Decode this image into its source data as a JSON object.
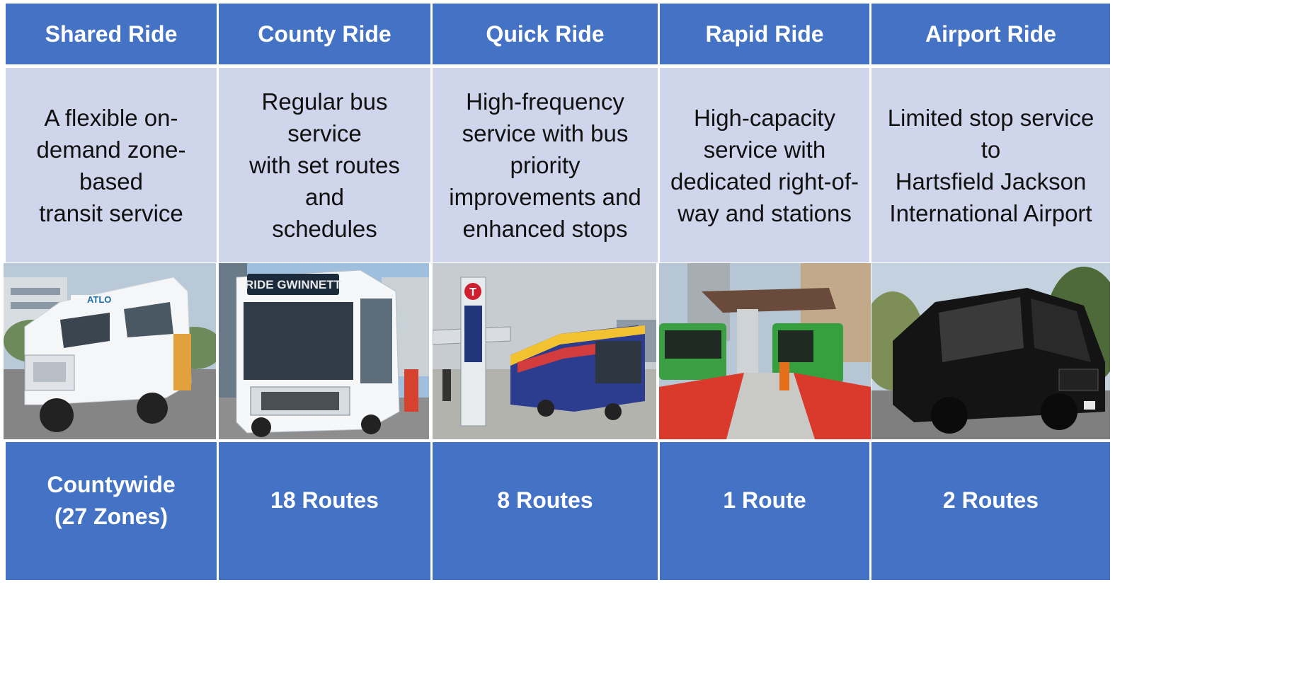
{
  "columns": [
    {
      "title": "Shared Ride",
      "description": "A flexible on-\ndemand zone-based\ntransit service",
      "coverage": "Countywide\n(27 Zones)",
      "photo": "white-cutaway-shuttle-bus",
      "vehicle_sign": "ATLO"
    },
    {
      "title": "County Ride",
      "description": "Regular bus service\nwith set routes and\nschedules",
      "coverage": "18 Routes",
      "photo": "white-transit-bus",
      "vehicle_sign": "RIDE GWINNETT"
    },
    {
      "title": "Quick Ride",
      "description": "High-frequency\nservice with bus\npriority\nimprovements and\nenhanced stops",
      "coverage": "8 Routes",
      "photo": "articulated-bus-at-station",
      "vehicle_sign": "T"
    },
    {
      "title": "Rapid Ride",
      "description": "High-capacity\nservice with\ndedicated right-of-\nway and stations",
      "coverage": "1 Route",
      "photo": "brt-station-green-buses",
      "vehicle_sign": ""
    },
    {
      "title": "Airport Ride",
      "description": "Limited stop service to\nHartsfield Jackson\nInternational Airport",
      "coverage": "2 Routes",
      "photo": "black-sprinter-van",
      "vehicle_sign": ""
    }
  ],
  "colors": {
    "header": "#4472c4",
    "description": "#cfd5ea",
    "footer": "#4472c4"
  }
}
